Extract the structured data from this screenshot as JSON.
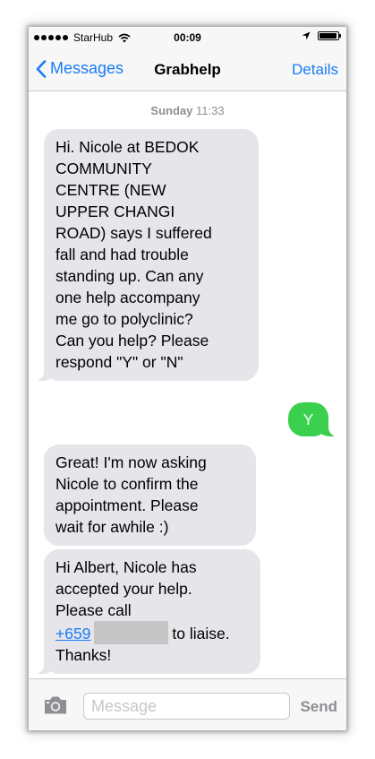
{
  "status_bar": {
    "carrier": "StarHub",
    "time": "00:09",
    "battery_level": 0.95
  },
  "nav": {
    "back_label": "Messages",
    "title": "Grabhelp",
    "details_label": "Details"
  },
  "conversation": {
    "day": "Sunday",
    "time": "11:33",
    "messages": [
      {
        "direction": "received",
        "lines": [
          "Hi. Nicole at BEDOK",
          "COMMUNITY",
          "CENTRE (NEW",
          "UPPER CHANGI",
          "ROAD) says I suffered",
          "fall and had trouble",
          "standing up. Can any",
          "one help accompany",
          "me go to polyclinic?",
          "Can you help? Please",
          "respond \"Y\" or \"N\""
        ]
      },
      {
        "direction": "sent",
        "text": "Y"
      },
      {
        "direction": "received",
        "lines": [
          "Great! I'm now asking",
          "Nicole to confirm the",
          "appointment. Please",
          "wait for awhile :)"
        ]
      },
      {
        "direction": "received",
        "line1": "Hi Albert, Nicole has",
        "line2": "accepted your help.",
        "line3": "Please call",
        "phone_prefix": "+659",
        "after_phone": "to liaise.",
        "line5": "Thanks!"
      }
    ]
  },
  "composer": {
    "placeholder": "Message",
    "value": "",
    "send_label": "Send"
  },
  "colors": {
    "accent": "#1a7cf5",
    "sent_bubble": "#3ad04d",
    "received_bubble": "#e5e5ea"
  }
}
